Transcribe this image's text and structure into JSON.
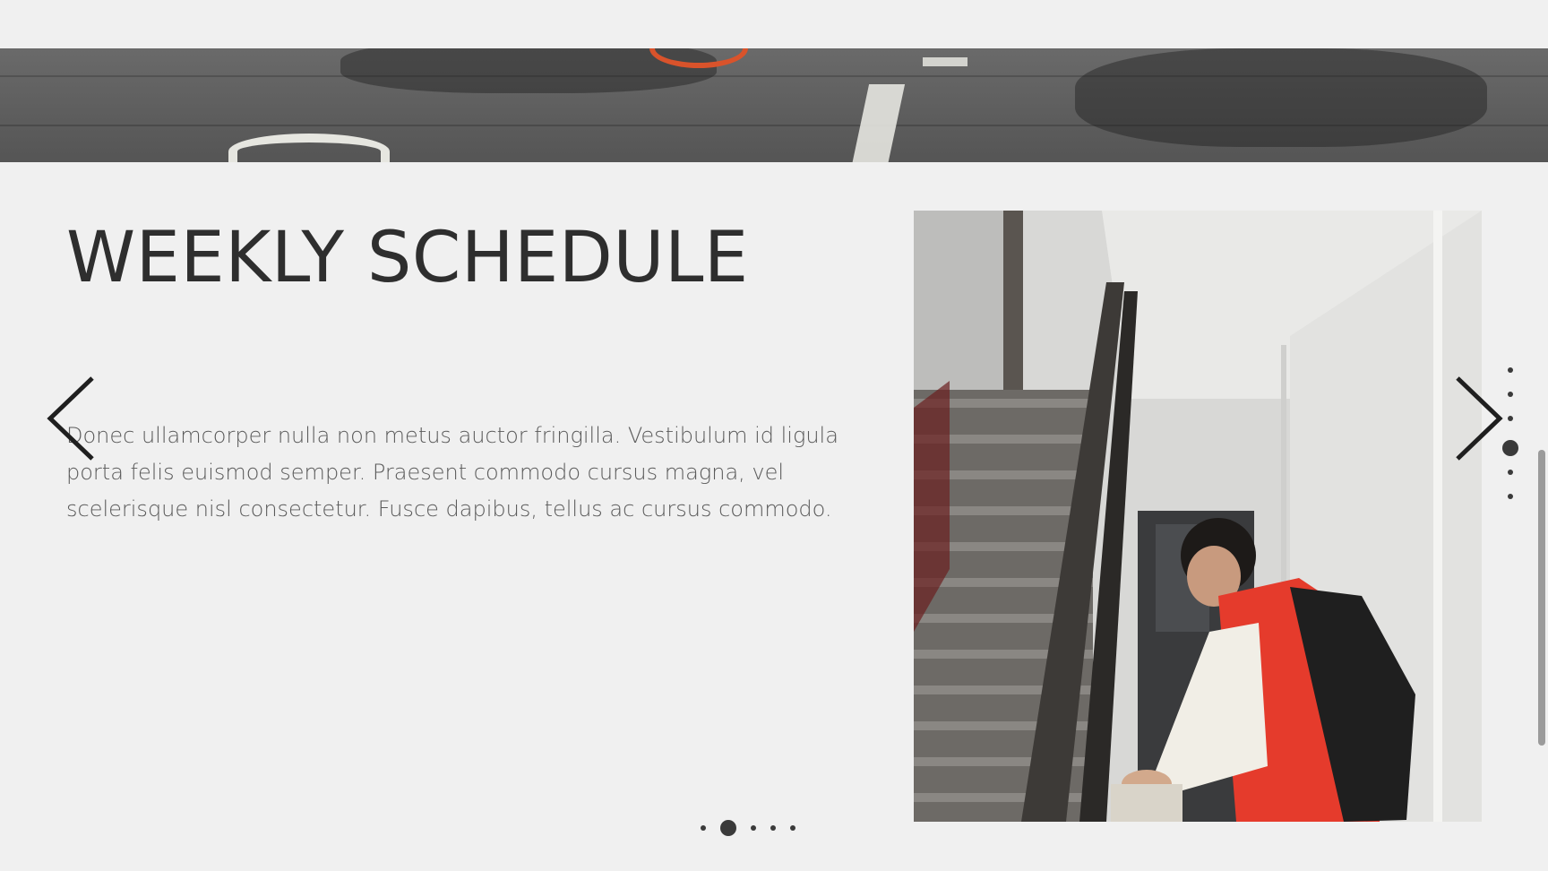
{
  "section": {
    "title": "WEEKLY SCHEDULE",
    "body": "Donec ullamcorper nulla non metus auctor fringilla. Vestibulum id ligula porta felis euismod semper. Praesent commodo cursus magna, vel scelerisque nisl consectetur. Fusce dapibus, tellus ac cursus commodo."
  },
  "navigation": {
    "prev_icon": "chevron-left-icon",
    "next_icon": "chevron-right-icon"
  },
  "slide_pagination": {
    "count": 5,
    "active_index": 1
  },
  "section_pagination": {
    "count": 6,
    "active_index": 3
  },
  "images": {
    "hero": "street pavement with bicycle shadow",
    "photo": "person in red vest at stairwell"
  },
  "colors": {
    "background": "#f0f0f0",
    "text_dark": "#2e2e2e",
    "text_body": "#5a5a5a",
    "accent_red": "#e53b2c"
  }
}
